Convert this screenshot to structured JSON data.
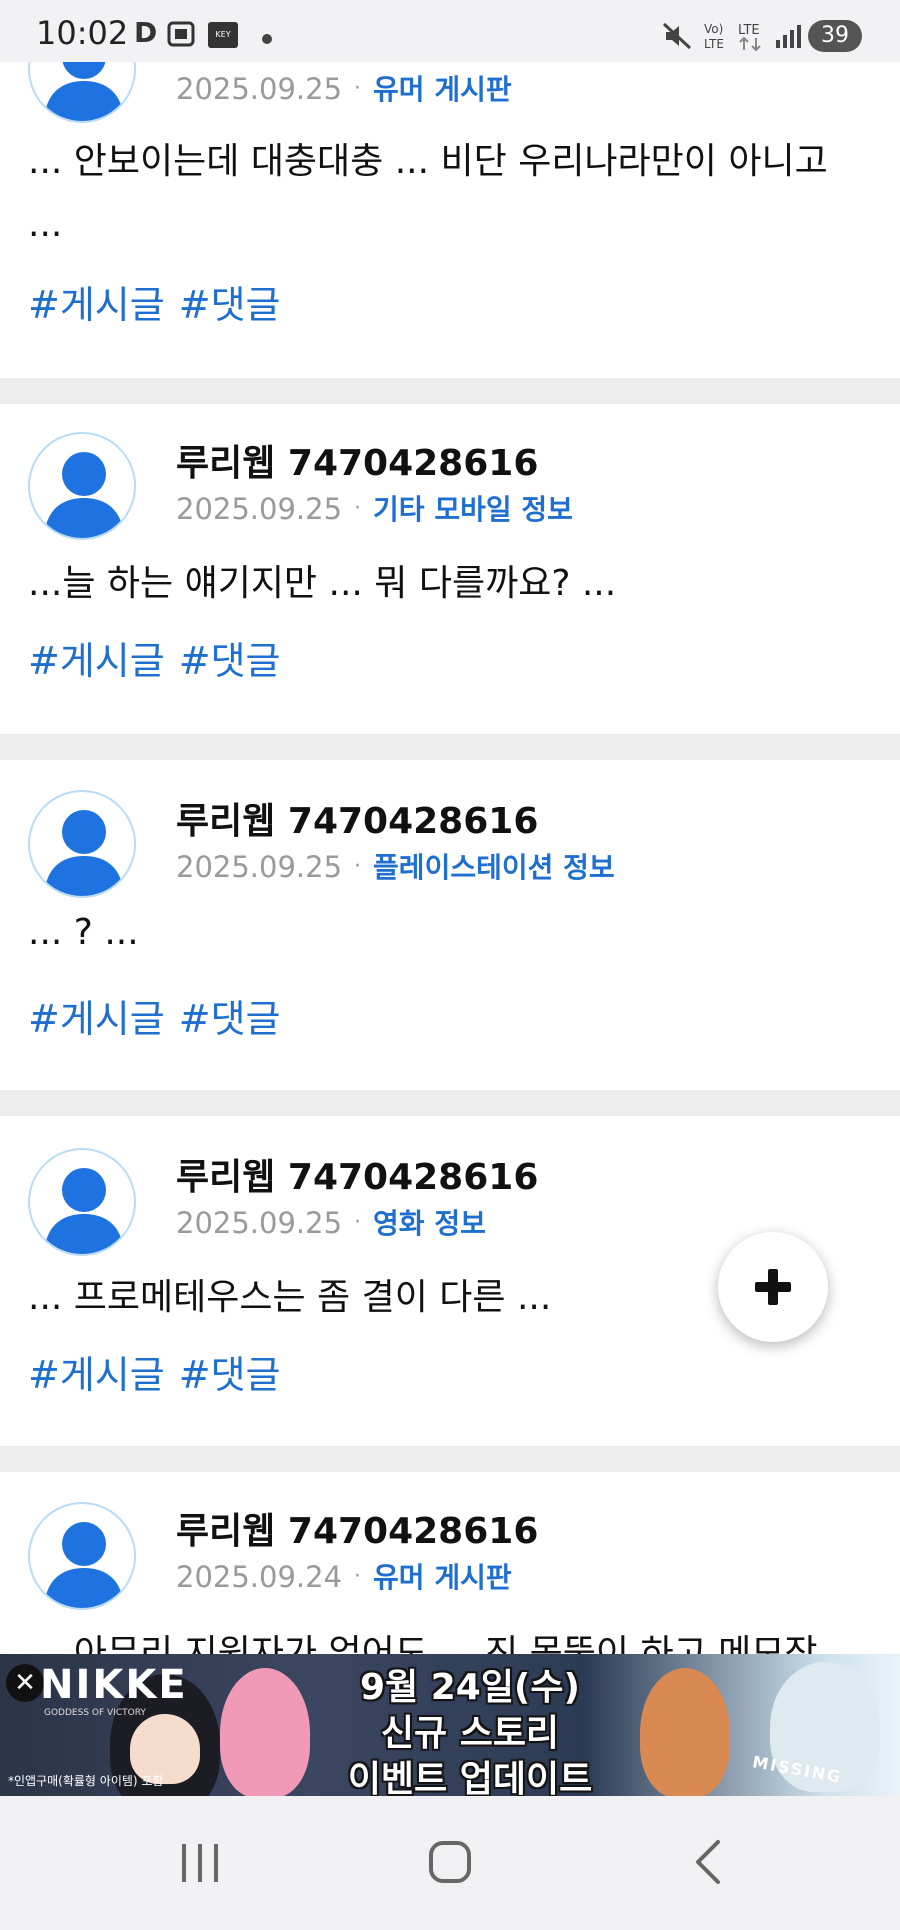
{
  "status_bar": {
    "time": "10:02",
    "battery": "39"
  },
  "posts": [
    {
      "author": "",
      "date": "2025.09.25",
      "board": "유머 게시판",
      "snippet_lines": [
        "... 안보이는데 대충대충 ... 비단 우리나라만이 아니고",
        "..."
      ],
      "tags": [
        "#게시글",
        "#댓글"
      ]
    },
    {
      "author": "루리웹 7470428616",
      "date": "2025.09.25",
      "board": "기타 모바일 정보",
      "snippet_lines": [
        "...늘 하는 얘기지만 ... 뭐 다를까요? ..."
      ],
      "tags": [
        "#게시글",
        "#댓글"
      ]
    },
    {
      "author": "루리웹 7470428616",
      "date": "2025.09.25",
      "board": "플레이스테이션 정보",
      "snippet_lines": [
        "... ? ..."
      ],
      "tags": [
        "#게시글",
        "#댓글"
      ]
    },
    {
      "author": "루리웹 7470428616",
      "date": "2025.09.25",
      "board": "영화 정보",
      "snippet_lines": [
        "... 프로메테우스는 좀 결이 다른 ..."
      ],
      "tags": [
        "#게시글",
        "#댓글"
      ]
    },
    {
      "author": "루리웹 7470428616",
      "date": "2025.09.24",
      "board": "유머 게시판",
      "snippet_lines": [
        "... 아무리 지원자가 없어도 ... 진 몸뚱이 하고 메모장"
      ],
      "tags": []
    }
  ],
  "separator": "·",
  "fab": {
    "icon": "plus-icon"
  },
  "ad": {
    "close_icon": "close-icon",
    "brand": "NIKKE",
    "brand_sub": "GODDESS OF VICTORY",
    "line1": "9월 24일(수)",
    "line2": "신규 스토리",
    "line3": "이벤트 업데이트",
    "note": "*인앱구매(확률형 아이템) 포함",
    "sign": "MISSING"
  },
  "nav": {
    "recents_icon": "recents-icon",
    "home_icon": "home-icon",
    "back_icon": "back-icon"
  },
  "colors": {
    "link_blue": "#1e6fd0",
    "avatar_blue": "#1f73e0",
    "divider_gray": "#ececec"
  }
}
